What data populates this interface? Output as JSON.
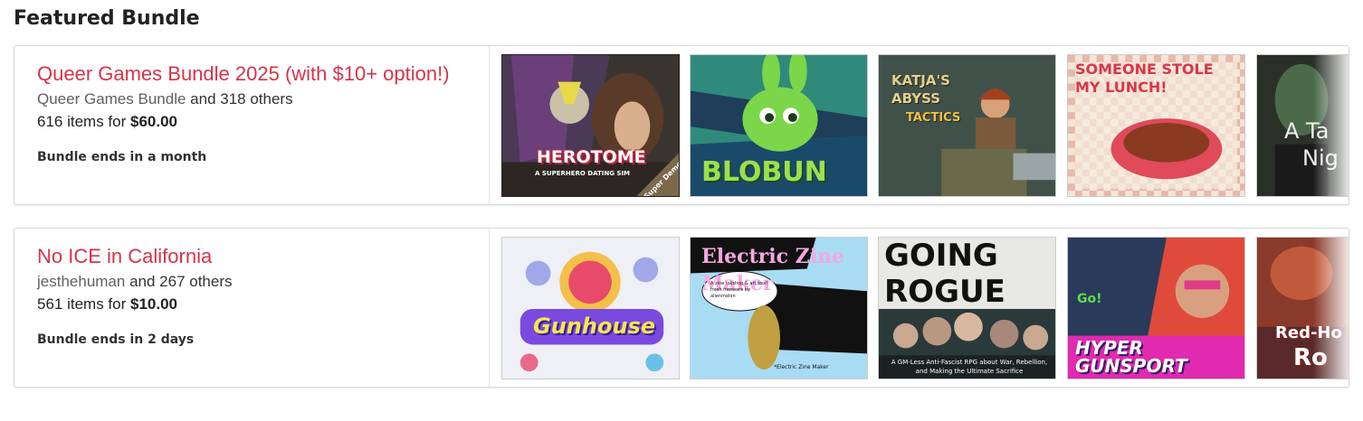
{
  "section_title": "Featured Bundle",
  "bundles": [
    {
      "title": "Queer Games Bundle 2025 (with $10+ option!)",
      "author": "Queer Games Bundle",
      "others": "and 318 others",
      "items_text": "616 items for",
      "price": "$60.00",
      "ends": "Bundle ends in a month",
      "thumbs": [
        {
          "title": "HEROTOME",
          "subtitle": "A SUPERHERO DATING SIM",
          "badge": "Super Demo"
        },
        {
          "title": "BLOBUN"
        },
        {
          "title": "KATJA'S ABYSS",
          "subtitle": "TACTICS"
        },
        {
          "title": "SOMEONE STOLE MY LUNCH!"
        },
        {
          "title": "A Ta",
          "subtitle": "Nig"
        }
      ]
    },
    {
      "title": "No ICE in California",
      "author": "jesthehuman",
      "others": "and 267 others",
      "items_text": "561 items for",
      "price": "$10.00",
      "ends": "Bundle ends in 2 days",
      "thumbs": [
        {
          "title": "Gunhouse"
        },
        {
          "title": "Electric Zine Maker",
          "subtitle": "A zine inkshop & art tool! fresh freeware by alienmelon",
          "caption": "*Electric Zine Maker"
        },
        {
          "title": "GOING ROGUE",
          "subtitle": "A GM-Less Anti-Fascist RPG about War, Rebellion, and Making the Ultimate Sacrifice"
        },
        {
          "title": "HYPER GUNSPORT",
          "subtitle": "Go!"
        },
        {
          "title": "Red-Ho",
          "subtitle": "Ro"
        }
      ]
    }
  ],
  "colors": {
    "accent": "#d8334a",
    "border": "#d8d8d8"
  }
}
